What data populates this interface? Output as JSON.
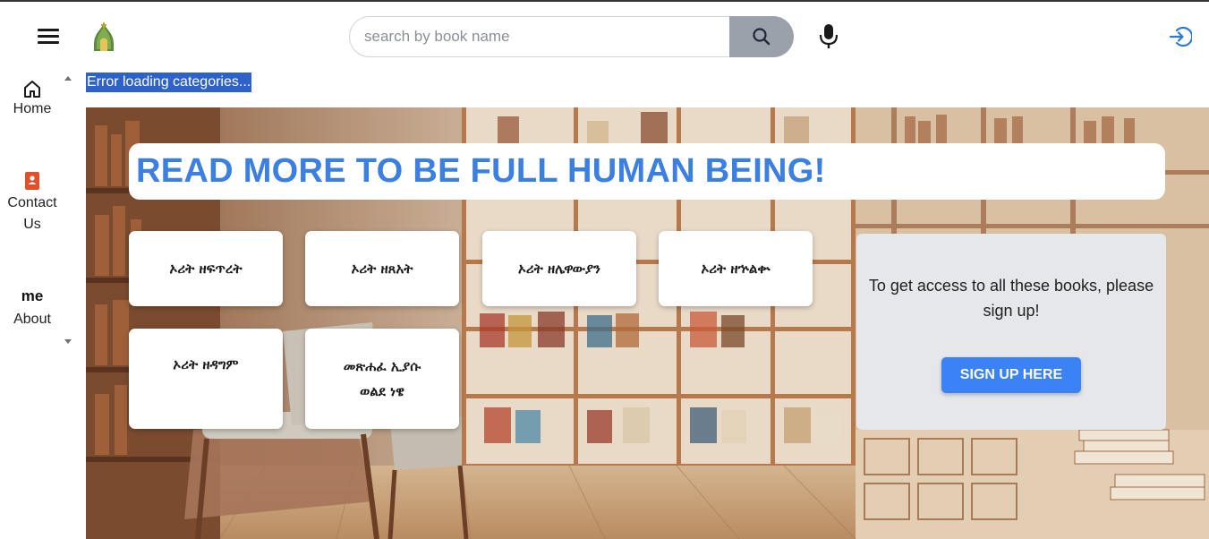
{
  "header": {
    "search": {
      "placeholder": "search by book name",
      "value": ""
    },
    "icons": {
      "menu": "hamburger-menu-icon",
      "logo": "church-logo",
      "search": "search-icon",
      "mic": "microphone-icon",
      "login": "login-icon"
    }
  },
  "sidebar": {
    "items": [
      {
        "label": "Home",
        "icon": "home-icon"
      },
      {
        "label": "Contact Us",
        "icon": "contact-book-icon"
      },
      {
        "label": "About",
        "icon_text": "me"
      }
    ]
  },
  "error": {
    "text": "Error loading categories..."
  },
  "hero": {
    "title": "READ MORE TO BE FULL HUMAN BEING!",
    "categories": [
      "ኦሪት ዘፍጥረት",
      "ኦሪት ዘጸአት",
      "ኦሪት ዘሌዋውያን",
      "ኦሪት ዘኍልቍ",
      "ኦሪት ዘዳግም",
      "መጽሐፈ ኢያሱ ወልደ ነዌ"
    ],
    "signup": {
      "message": "To get access to all these books, please sign up!",
      "button_label": "SIGN UP HERE"
    }
  },
  "colors": {
    "accent": "#3b7fe0",
    "button": "#3b82f6",
    "error_bg": "#2f62c9",
    "search_btn": "#9aa1ab",
    "panel": "#e6e7eb"
  }
}
